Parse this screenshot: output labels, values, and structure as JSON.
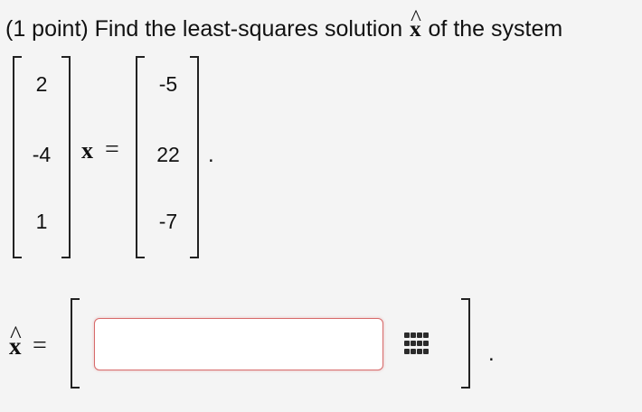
{
  "problem": {
    "points_prefix": "(1 point) Find the least-squares solution ",
    "hat_symbol": "^",
    "x_symbol": "x",
    "suffix": " of the system"
  },
  "system": {
    "matrix_A": [
      "2",
      "-4",
      "1"
    ],
    "variable": "x",
    "equals": "=",
    "vector_b": [
      "-5",
      "22",
      "-7"
    ],
    "period": "."
  },
  "answer": {
    "label_hat": "^",
    "label_x": "x",
    "equals": "=",
    "input_value": "",
    "period": "."
  },
  "icons": {
    "keypad": "keypad-grid-icon"
  },
  "colors": {
    "background": "#f4f4f4",
    "input_border": "#d76b6b",
    "text": "#111111"
  }
}
